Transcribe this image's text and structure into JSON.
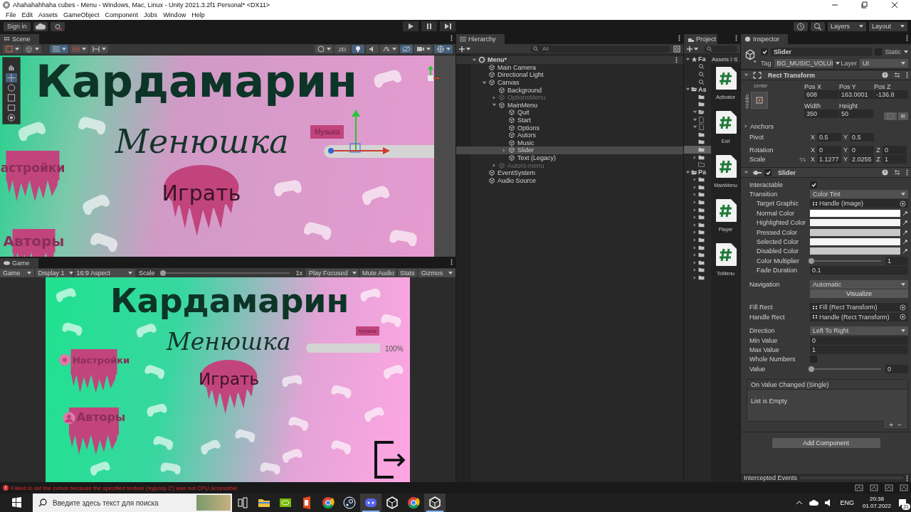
{
  "window": {
    "title": "Ahahahahhaha cubes - Menu - Windows, Mac, Linux - Unity 2021.3.2f1 Personal* <DX11>",
    "menu": [
      "File",
      "Edit",
      "Assets",
      "GameObject",
      "Component",
      "Jobs",
      "Window",
      "Help"
    ]
  },
  "toolbar": {
    "sign_in": "Sign in",
    "layers": "Layers",
    "layout": "Layout"
  },
  "scene": {
    "tab": "Scene",
    "mode_2d": "2D",
    "canvas": {
      "title": "Кардамарин",
      "subtitle": "Менюшка",
      "play": "Играть",
      "settings": "астройки",
      "authors": "Авторы",
      "music": "Музыка",
      "slider": {
        "level": 1
      }
    }
  },
  "game": {
    "tab": "Game",
    "toolbar": [
      {
        "label": "Game",
        "kind": "dropdown"
      },
      {
        "label": "Display 1",
        "kind": "dropdown"
      },
      {
        "label": "16:9 Aspect",
        "kind": "dropdown"
      },
      {
        "label": "Scale",
        "kind": "scale",
        "level": 0,
        "value": "1x"
      },
      {
        "label": "Play Focused",
        "kind": "dropdown"
      },
      {
        "label": "Mute Audio",
        "kind": "toggle"
      },
      {
        "label": "Stats",
        "kind": "toggle"
      },
      {
        "label": "Gizmos",
        "kind": "dropdown"
      }
    ],
    "canvas": {
      "title": "Кардамарин",
      "subtitle": "Менюшка",
      "play": "Играть",
      "settings": "Настройки",
      "authors": "Авторы",
      "music": "Музыка",
      "slider": {
        "level": 1
      },
      "percent": "100%"
    }
  },
  "hierarchy": {
    "tab": "Hierarchy",
    "search_placeholder": "All",
    "tree": [
      {
        "label": "Menu*",
        "kind": "scene",
        "expanded": true,
        "selected": false,
        "disabled": false,
        "children": [
          {
            "label": "Main Camera",
            "kind": "object",
            "selected": false,
            "disabled": false
          },
          {
            "label": "Directional Light",
            "kind": "object",
            "selected": false,
            "disabled": false
          },
          {
            "label": "Canvas",
            "kind": "object",
            "expanded": true,
            "selected": false,
            "disabled": false,
            "children": [
              {
                "label": "Background",
                "kind": "object",
                "selected": false,
                "disabled": false
              },
              {
                "label": "OptionsMenu",
                "kind": "object",
                "expanded": false,
                "selected": false,
                "disabled": true
              },
              {
                "label": "MainMenu",
                "kind": "object",
                "expanded": true,
                "selected": false,
                "disabled": false,
                "children": [
                  {
                    "label": "Quit",
                    "kind": "object",
                    "selected": false,
                    "disabled": false
                  },
                  {
                    "label": "Start",
                    "kind": "object",
                    "selected": false,
                    "disabled": false
                  },
                  {
                    "label": "Options",
                    "kind": "object",
                    "selected": false,
                    "disabled": false
                  },
                  {
                    "label": "Autors",
                    "kind": "object",
                    "selected": false,
                    "disabled": false
                  },
                  {
                    "label": "Music",
                    "kind": "object",
                    "selected": false,
                    "disabled": false
                  },
                  {
                    "label": "Slider",
                    "kind": "object",
                    "expanded": false,
                    "selected": true,
                    "disabled": false
                  },
                  {
                    "label": "Text (Legacy)",
                    "kind": "object",
                    "selected": false,
                    "disabled": false
                  }
                ]
              },
              {
                "label": "Autors-menu",
                "kind": "object",
                "expanded": false,
                "selected": false,
                "disabled": true
              }
            ]
          },
          {
            "label": "EventSystem",
            "kind": "object",
            "selected": false,
            "disabled": false
          },
          {
            "label": "Audio Source",
            "kind": "object",
            "selected": false,
            "disabled": false
          }
        ]
      }
    ]
  },
  "project": {
    "tab": "Project",
    "breadcrumb": [
      "Assets",
      "S"
    ],
    "tree": [
      {
        "label": "Fa",
        "kind": "star",
        "expanded": true,
        "selected": false
      },
      {
        "kind": "search",
        "selected": false
      },
      {
        "kind": "search",
        "selected": false
      },
      {
        "kind": "search",
        "selected": false
      },
      {
        "label": "As",
        "kind": "open",
        "expanded": true,
        "selected": false
      },
      {
        "kind": "folder",
        "selected": false
      },
      {
        "kind": "folder",
        "selected": false
      },
      {
        "kind": "open",
        "expanded": true,
        "selected": false
      },
      {
        "kind": "file",
        "expanded": true,
        "selected": false
      },
      {
        "kind": "file",
        "expanded": true,
        "selected": false
      },
      {
        "kind": "folder",
        "selected": false
      },
      {
        "kind": "folder",
        "selected": false
      },
      {
        "kind": "folder",
        "selected": true
      },
      {
        "kind": "folder",
        "expanded": false,
        "selected": false
      },
      {
        "kind": "empty",
        "selected": false
      },
      {
        "label": "Pa",
        "kind": "open",
        "expanded": true,
        "selected": false
      },
      {
        "kind": "folder",
        "expanded": false,
        "selected": false
      },
      {
        "kind": "folder",
        "expanded": false,
        "selected": false
      },
      {
        "kind": "folder",
        "expanded": false,
        "selected": false
      },
      {
        "kind": "folder",
        "expanded": false,
        "selected": false
      },
      {
        "kind": "folder",
        "expanded": false,
        "selected": false
      },
      {
        "kind": "folder",
        "expanded": false,
        "selected": false
      },
      {
        "kind": "folder",
        "expanded": false,
        "selected": false
      },
      {
        "kind": "folder",
        "expanded": false,
        "selected": false
      },
      {
        "kind": "folder",
        "expanded": false,
        "selected": false
      },
      {
        "kind": "folder",
        "expanded": false,
        "selected": false
      },
      {
        "kind": "folder",
        "expanded": false,
        "selected": false
      },
      {
        "kind": "folder",
        "expanded": false,
        "selected": false
      },
      {
        "kind": "folder",
        "expanded": false,
        "selected": false
      },
      {
        "kind": "folder",
        "expanded": false,
        "selected": false
      }
    ],
    "assets": [
      {
        "label": "Activator"
      },
      {
        "label": "Exit"
      },
      {
        "label": "MainMenu"
      },
      {
        "label": "Player"
      },
      {
        "label": "ToMenu"
      }
    ]
  },
  "inspector": {
    "tab": "Inspector",
    "object": {
      "name": "Slider",
      "active": true,
      "static_label": "Static",
      "static": false,
      "tag_label": "Tag",
      "tag": "BG_MUSIC_VOLUI",
      "layer_label": "Layer",
      "layer": "UI"
    },
    "rect_transform": {
      "title": "Rect Transform",
      "expanded": true,
      "anchor_h": "center",
      "anchor_v": "middle",
      "fields": [
        {
          "label": "Pos X",
          "value": "608"
        },
        {
          "label": "Pos Y",
          "value": "163.0001"
        },
        {
          "label": "Pos Z",
          "value": "-136.8"
        },
        {
          "label": "Width",
          "value": "350"
        },
        {
          "label": "Height",
          "value": "50"
        }
      ],
      "raw_button": "R",
      "rows": [
        {
          "label": "Anchors",
          "kind": "foldout",
          "expanded": false
        },
        {
          "label": "Pivot",
          "kind": "vector",
          "parts": [
            {
              "axis": "X",
              "value": "0.5"
            },
            {
              "axis": "Y",
              "value": "0.5"
            }
          ]
        },
        {
          "label": "Rotation",
          "kind": "vector",
          "parts": [
            {
              "axis": "X",
              "value": "0"
            },
            {
              "axis": "Y",
              "value": "0"
            },
            {
              "axis": "Z",
              "value": "0"
            }
          ]
        },
        {
          "label": "Scale",
          "kind": "vector",
          "linked": false,
          "parts": [
            {
              "axis": "X",
              "value": "1.1277"
            },
            {
              "axis": "Y",
              "value": "2.0255"
            },
            {
              "axis": "Z",
              "value": "1"
            }
          ]
        }
      ]
    },
    "slider": {
      "title": "Slider",
      "enabled": true,
      "expanded": true,
      "groups": [
        [
          {
            "label": "Interactable",
            "kind": "checkbox",
            "checked": true
          },
          {
            "label": "Transition",
            "kind": "dropdown",
            "value": "Color Tint",
            "children": [
              {
                "label": "Target Graphic",
                "kind": "object",
                "value": "Handle (Image)"
              },
              {
                "label": "Normal Color",
                "kind": "color",
                "color": "#ffffff"
              },
              {
                "label": "Highlighted Color",
                "kind": "color",
                "color": "#f5f5f5"
              },
              {
                "label": "Pressed Color",
                "kind": "color",
                "color": "#c8c8c8"
              },
              {
                "label": "Selected Color",
                "kind": "color",
                "color": "#f5f5f5"
              },
              {
                "label": "Disabled Color",
                "kind": "color",
                "color": "#c8c8c8"
              },
              {
                "label": "Color Multiplier",
                "kind": "slider",
                "level": 0,
                "value": "1"
              },
              {
                "label": "Fade Duration",
                "kind": "text",
                "value": "0.1"
              }
            ]
          }
        ],
        [
          {
            "label": "Navigation",
            "kind": "dropdown",
            "value": "Automatic"
          },
          {
            "kind": "button",
            "value": "Visualize"
          }
        ],
        [
          {
            "label": "Fill Rect",
            "kind": "object",
            "value": "Fill (Rect Transform)"
          },
          {
            "label": "Handle Rect",
            "kind": "object",
            "value": "Handle (Rect Transform)"
          }
        ],
        [
          {
            "label": "Direction",
            "kind": "dropdown",
            "value": "Left To Right"
          },
          {
            "label": "Min Value",
            "kind": "text",
            "value": "0"
          },
          {
            "label": "Max Value",
            "kind": "text",
            "value": "1"
          },
          {
            "label": "Whole Numbers",
            "kind": "checkbox",
            "checked": false
          },
          {
            "label": "Value",
            "kind": "slider",
            "level": 0,
            "value": "0"
          }
        ]
      ]
    },
    "event": {
      "title": "On Value Changed (Single)",
      "empty": "List is Empty",
      "add": "+",
      "remove": "−"
    },
    "add_component": "Add Component",
    "intercepted_events": "Intercepted Events"
  },
  "status": {
    "error": "Failed to set the cursor because the specified texture ('курсор 2') was not CPU accessible."
  },
  "taskbar": {
    "search_placeholder": "Введите здесь текст для поиска",
    "apps": [
      {
        "kind": "taskview",
        "active": false
      },
      {
        "kind": "explorer",
        "active": false
      },
      {
        "kind": "nvidia",
        "active": false
      },
      {
        "kind": "office",
        "active": false
      },
      {
        "kind": "chrome",
        "active": false
      },
      {
        "kind": "steam",
        "active": false
      },
      {
        "kind": "discord",
        "active": true
      },
      {
        "kind": "unity",
        "active": false
      },
      {
        "kind": "chrome",
        "active": false
      },
      {
        "kind": "unity",
        "active": true
      }
    ],
    "language": "ENG",
    "time": "20:38",
    "date": "01.07.2022",
    "notifications": "21"
  }
}
